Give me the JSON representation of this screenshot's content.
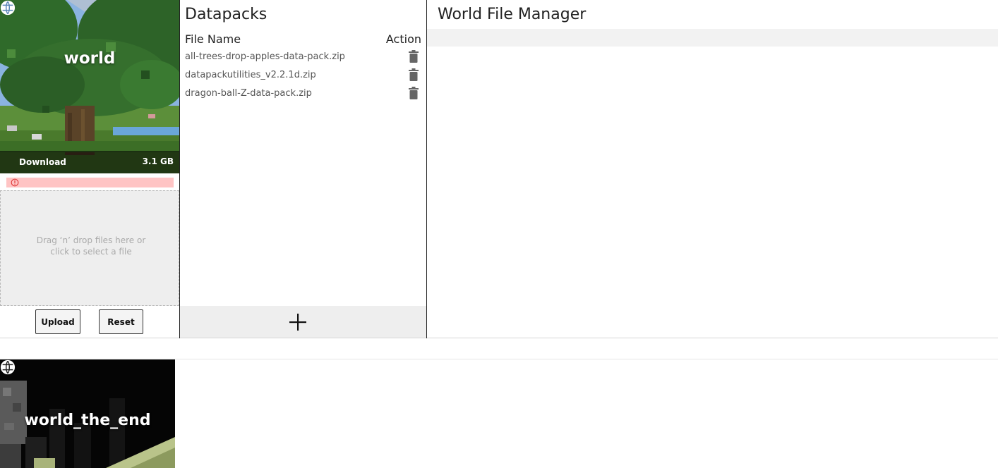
{
  "worlds": [
    {
      "name": "world",
      "download_label": "Download",
      "size": "3.1 GB",
      "dropzone_text": "Drag ‘n’ drop files here or click to select a file",
      "upload_label": "Upload",
      "reset_label": "Reset",
      "icon": "globe-icon",
      "error_icon": "alert-circle-icon"
    },
    {
      "name": "world_the_end",
      "icon": "globe-icon"
    }
  ],
  "datapacks": {
    "title": "Datapacks",
    "columns": {
      "name": "File Name",
      "action": "Action"
    },
    "files": [
      "all-trees-drop-apples-data-pack.zip",
      "datapackutilities_v2.2.1d.zip",
      "dragon-ball-Z-data-pack.zip"
    ],
    "row_action_icon": "trash-icon",
    "add_icon": "plus-icon"
  },
  "file_manager": {
    "title": "World File Manager"
  },
  "colors": {
    "error_bg": "#ffc4c4",
    "panel_bg": "#eeeeee",
    "strip_bg": "#f2f2f2",
    "trash": "#666666"
  }
}
